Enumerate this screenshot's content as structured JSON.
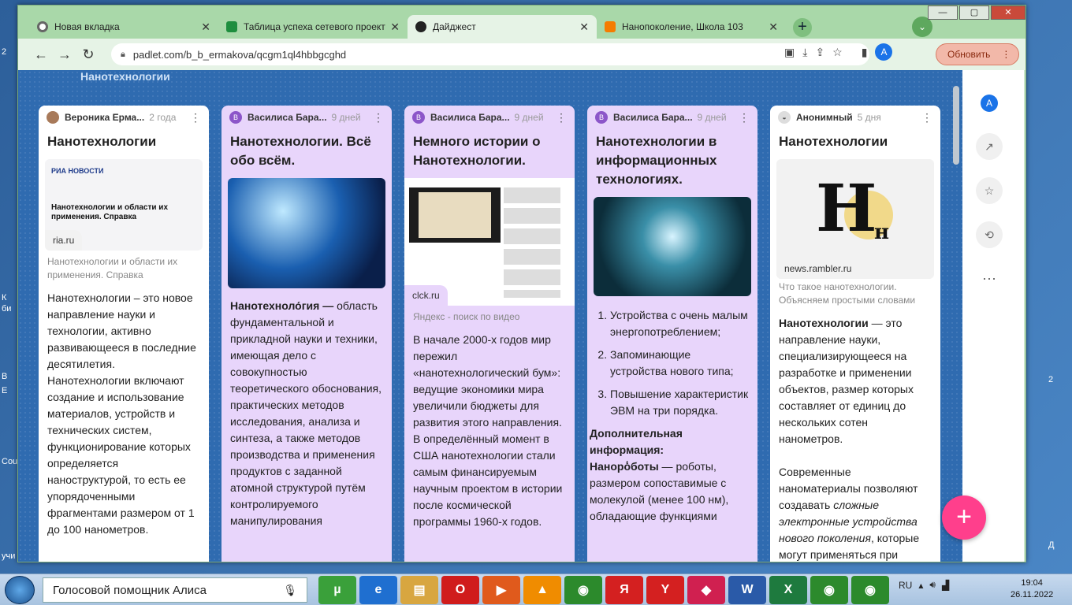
{
  "desktop": {
    "labels": [
      "2",
      "К",
      "би",
      "В",
      "Е",
      "Cou",
      "учи",
      "Д",
      "2"
    ]
  },
  "browser": {
    "tabs": [
      {
        "title": "Новая вкладка",
        "color": "#ffffff",
        "active": false
      },
      {
        "title": "Таблица успеха сетевого проект",
        "color": "#1e8e3e",
        "active": false
      },
      {
        "title": "Дайджест",
        "color": "#222222",
        "active": true
      },
      {
        "title": "Нанопоколение, Школа 103",
        "color": "#f57c00",
        "active": false
      }
    ],
    "url": "padlet.com/b_b_ermakova/qcgm1ql4hbbgcghd",
    "update_label": "Обновить",
    "avatar_letter": "A",
    "window_controls": [
      "—",
      "▢",
      "✕"
    ]
  },
  "padlet": {
    "section_title": "Нанотехнологии",
    "cards": [
      {
        "author": "Вероника Ерма...",
        "time": "2 года",
        "title": "Нанотехнологии",
        "img_site": "РИА НОВОСТИ",
        "img_text": "Нанотехнологии и области их применения. Справка",
        "link": "ria.ru",
        "caption": "Нанотехнологии и области их применения. Справка",
        "body": "Нанотехнологии – это новое направление науки и технологии, активно развивающееся в последние десятилетия. Нанотехнологии включают создание и использование материалов, устройств и технических систем, функционирование которых определяется наноструктурой, то есть ее упорядоченными фрагментами размером от 1 до 100 нанометров."
      },
      {
        "author": "Василиса Бара...",
        "time": "9 дней",
        "avatar": "В",
        "title": "Нанотехнологии. Всё обо всём.",
        "body_bold": "Нанотехноло́гия —",
        "body": " область фундаментальной и прикладной науки и техники, имеющая дело с совокупностью теоретического обоснования, практических методов исследования, анализа и синтеза, а также методов производства и применения продуктов с заданной атомной структурой путём контролируемого манипулирования"
      },
      {
        "author": "Василиса Бара...",
        "time": "9 дней",
        "avatar": "В",
        "title": "Немного истории о Нанотехнологии.",
        "link": "clck.ru",
        "caption": "Яндекс - поиск по видео",
        "body": "В начале 2000-х годов мир пережил «нанотехнологический бум»: ведущие экономики мира увеличили бюджеты для развития этого направления. В определённый момент в США нанотехнологии стали самым финансируемым научным проектом в истории после космической программы 1960-х годов."
      },
      {
        "author": "Василиса Бара...",
        "time": "9 дней",
        "avatar": "В",
        "title": "Нанотехнологии в информационных технологиях.",
        "list": [
          "Устройства с очень малым энергопотреблением;",
          "Запоминающие устройства нового типа;",
          "Повышение характеристик ЭВМ на три порядка."
        ],
        "extra_bold": "Дополнительная информация:",
        "robots_bold": "Нанорo̒боты",
        "robots": " — роботы, размером сопоставимые с молекулой (менее 100 нм), обладающие функциями"
      },
      {
        "author": "Анонимный",
        "time": "5 дня",
        "title": "Нанотехнологии",
        "link": "news.rambler.ru",
        "logo_big": "H",
        "logo_small": "н",
        "caption": "Что такое нанотехнологии. Объясняем простыми словами",
        "body_bold": "Нанотехнологии",
        "body": " — это направление науки, специализирующееся на разработке и применении объектов, размер которых составляет от единиц до нескольких сотен нанометров.",
        "body2_a": "Современные наноматериалы позволяют создавать ",
        "body2_i": "сложные электронные устройства нового поколения",
        "body2_b": ", которые могут применяться при"
      }
    ]
  },
  "taskbar": {
    "search_text": "Голосовой помощник Алиса",
    "lang": "RU",
    "time": "19:04",
    "date": "26.11.2022",
    "apps": [
      "µ",
      "e",
      "▤",
      "O",
      "▶",
      "▲",
      "◉",
      "Я",
      "Y",
      "◆",
      "W",
      "X",
      "◉",
      "◉"
    ],
    "app_colors": [
      "#3aa03a",
      "#1f6fd0",
      "#d8a640",
      "#d01c1c",
      "#e05a1c",
      "#f08c00",
      "#2c8a2c",
      "#d42020",
      "#d42020",
      "#d02050",
      "#2a5aa8",
      "#1e7a3e",
      "#2c8a2c",
      "#2c8a2c"
    ]
  }
}
